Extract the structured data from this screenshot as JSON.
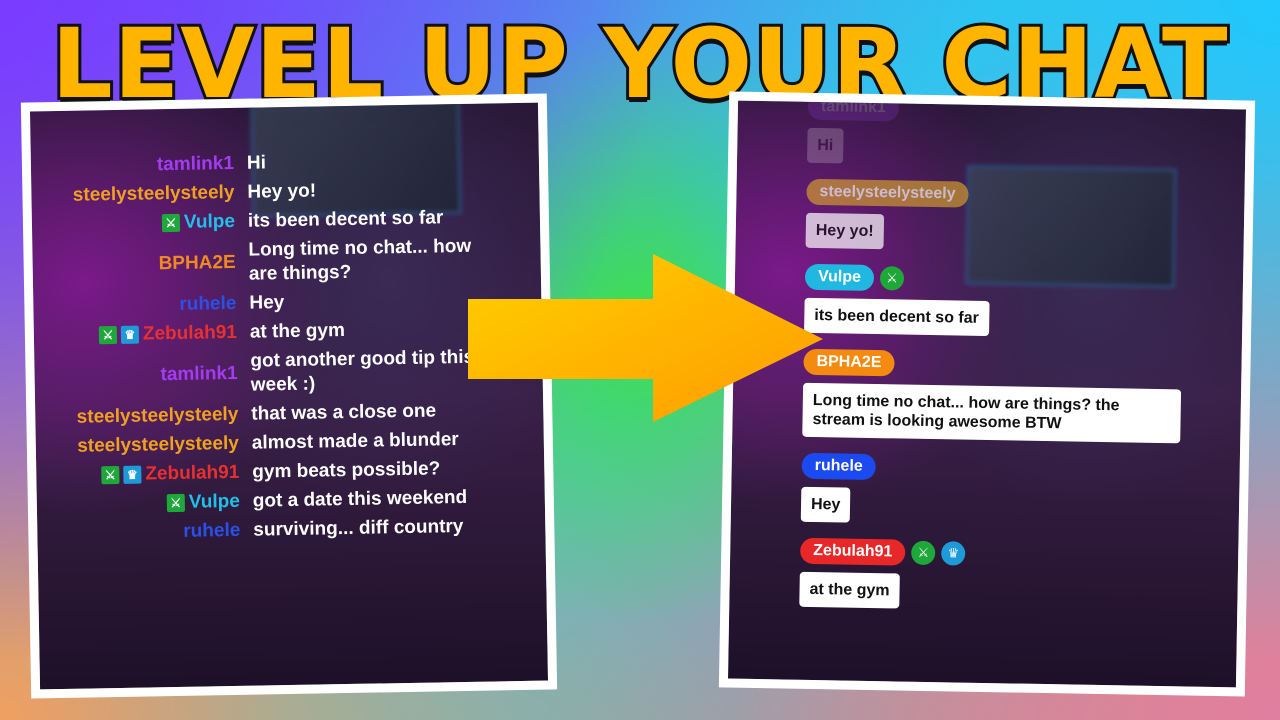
{
  "title": "LEVEL UP YOUR CHAT",
  "colors": {
    "title": "#ffb400",
    "arrow": "#ffb000",
    "sword_badge": "#1fa83a",
    "crown_badge": "#1e9ad8"
  },
  "icons": {
    "sword": "sword-icon",
    "crown": "crown-icon"
  },
  "left_chat": [
    {
      "user": "tamlink1",
      "color": "#a23cf0",
      "badges": [],
      "text": "Hi"
    },
    {
      "user": "steelysteelysteely",
      "color": "#f0a020",
      "badges": [],
      "text": "Hey yo!"
    },
    {
      "user": "Vulpe",
      "color": "#20c0e8",
      "badges": [
        "sword"
      ],
      "text": "its been decent so far"
    },
    {
      "user": "BPHA2E",
      "color": "#f08a20",
      "badges": [],
      "text": "Long time no chat... how are things?"
    },
    {
      "user": "ruhele",
      "color": "#2a50e8",
      "badges": [],
      "text": "Hey"
    },
    {
      "user": "Zebulah91",
      "color": "#e83030",
      "badges": [
        "sword",
        "crown"
      ],
      "text": "at the gym"
    },
    {
      "user": "tamlink1",
      "color": "#a23cf0",
      "badges": [],
      "text": "got another good tip this week :)"
    },
    {
      "user": "steelysteelysteely",
      "color": "#f0a020",
      "badges": [],
      "text": "that was a close one"
    },
    {
      "user": "steelysteelysteely",
      "color": "#f0a020",
      "badges": [],
      "text": "almost made a blunder"
    },
    {
      "user": "Zebulah91",
      "color": "#e83030",
      "badges": [
        "sword",
        "crown"
      ],
      "text": "gym beats possible?"
    },
    {
      "user": "Vulpe",
      "color": "#20c0e8",
      "badges": [
        "sword"
      ],
      "text": "got a date this weekend"
    },
    {
      "user": "ruhele",
      "color": "#2a50e8",
      "badges": [],
      "text": "surviving... diff country"
    }
  ],
  "right_chat": [
    {
      "user": "tamlink1",
      "color": "#a23cf0",
      "badges": [],
      "text": "Hi",
      "faded": 0.2
    },
    {
      "user": "steelysteelysteely",
      "color": "#d09a30",
      "badges": [],
      "text": "Hey yo!",
      "faded": 0.7
    },
    {
      "user": "Vulpe",
      "color": "#20b8e0",
      "badges": [
        "sword"
      ],
      "text": "its been decent so far",
      "faded": 1
    },
    {
      "user": "BPHA2E",
      "color": "#f58a10",
      "badges": [],
      "text": "Long time no chat... how are things? the stream is looking awesome BTW",
      "faded": 1
    },
    {
      "user": "ruhele",
      "color": "#1a4af0",
      "badges": [],
      "text": "Hey",
      "faded": 1
    },
    {
      "user": "Zebulah91",
      "color": "#e82828",
      "badges": [
        "sword",
        "crown"
      ],
      "text": "at the gym",
      "faded": 1
    }
  ]
}
